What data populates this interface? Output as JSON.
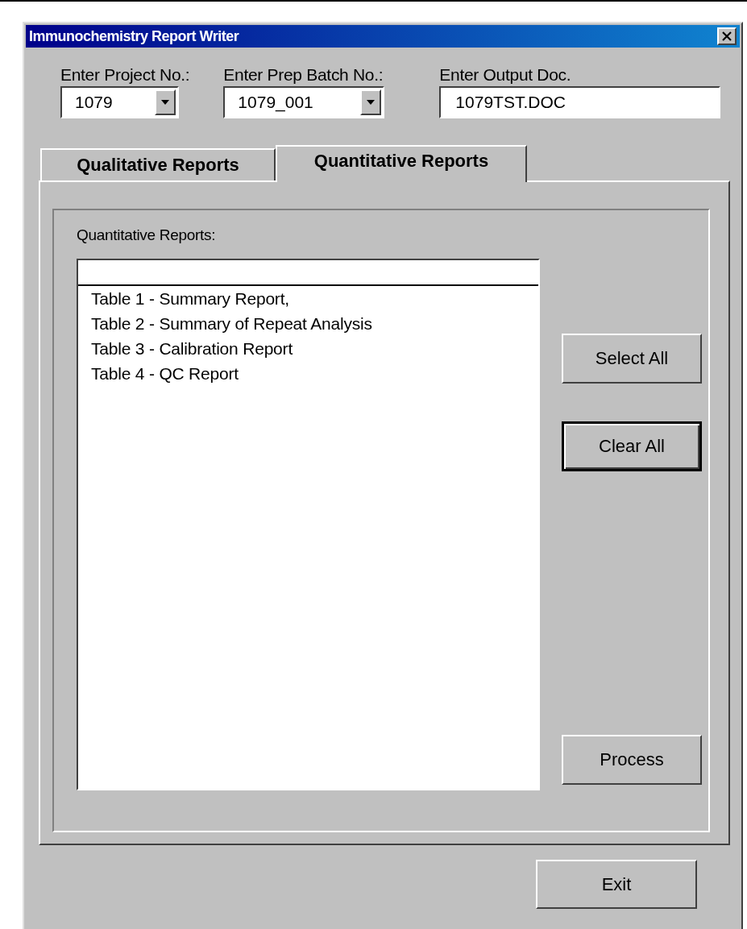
{
  "window": {
    "title": "Immunochemistry Report Writer"
  },
  "fields": [
    {
      "kind": "dropdown",
      "label": "Enter Project No.:",
      "value": "1079"
    },
    {
      "kind": "dropdown",
      "label": "Enter Prep Batch No.:",
      "value": "1079_001"
    },
    {
      "kind": "text",
      "label": "Enter Output Doc.",
      "value": "1079TST.DOC"
    }
  ],
  "tabs": [
    {
      "label": "Qualitative Reports",
      "selected": false
    },
    {
      "label": "Quantitative Reports",
      "selected": true
    }
  ],
  "panel": {
    "label": "Quantitative Reports:",
    "items": [
      "Table 1 - Summary Report,",
      "Table 2 - Summary of Repeat Analysis",
      "Table 3 - Calibration Report",
      "Table 4 - QC Report"
    ],
    "buttons": [
      {
        "label": "Select All",
        "focused": false
      },
      {
        "label": "Clear All",
        "focused": true
      },
      {
        "label": "Process",
        "focused": false
      }
    ]
  },
  "exit_button": {
    "label": "Exit"
  }
}
